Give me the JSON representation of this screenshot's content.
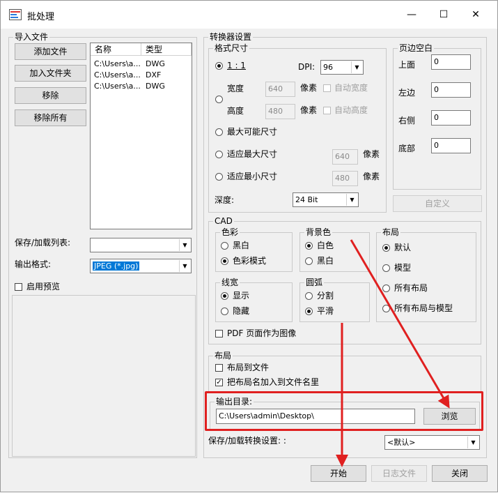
{
  "window": {
    "title": "批处理",
    "min": "—",
    "max": "☐",
    "close": "✕"
  },
  "import": {
    "title": "导入文件",
    "add_file": "添加文件",
    "add_folder": "加入文件夹",
    "remove": "移除",
    "remove_all": "移除所有",
    "columns": [
      "名称",
      "类型"
    ],
    "rows": [
      {
        "name": "C:\\Users\\a...",
        "type": "DWG"
      },
      {
        "name": "C:\\Users\\a...",
        "type": "DXF"
      },
      {
        "name": "C:\\Users\\a...",
        "type": "DWG"
      }
    ],
    "save_load_list_label": "保存/加载列表:",
    "save_load_list_value": "",
    "output_format_label": "输出格式:",
    "output_format_value": "JPEG (*.jpg)",
    "preview_label": "启用预览"
  },
  "converter": {
    "title": "转换器设置",
    "format_size": {
      "title": "格式尺寸",
      "ratio_label": "1 : 1",
      "dpi_label": "DPI:",
      "dpi_value": "96",
      "width_label": "宽度",
      "width_value": "640",
      "height_label": "高度",
      "height_value": "480",
      "pixel_label": "像素",
      "auto_width": "自动宽度",
      "auto_height": "自动高度",
      "max_size": "最大可能尺寸",
      "fit_max": "适应最大尺寸",
      "fit_max_value": "640",
      "fit_min": "适应最小尺寸",
      "fit_min_value": "480",
      "depth_label": "深度:",
      "depth_value": "24 Bit"
    },
    "margins": {
      "title": "页边空白",
      "top_label": "上面",
      "top_value": "0",
      "left_label": "左边",
      "left_value": "0",
      "right_label": "右侧",
      "right_value": "0",
      "bottom_label": "底部",
      "bottom_value": "0",
      "custom_button": "自定义"
    },
    "cad": {
      "title": "CAD",
      "color": {
        "title": "色彩",
        "bw": "黑白",
        "color_mode": "色彩模式"
      },
      "background": {
        "title": "背景色",
        "white": "白色",
        "black": "黑白"
      },
      "layout": {
        "title": "布局",
        "default": "默认",
        "model": "模型",
        "all_layouts": "所有布局",
        "all_layouts_model": "所有布局与模型"
      },
      "lineweight": {
        "title": "线宽",
        "show": "显示",
        "hide": "隐藏"
      },
      "arc": {
        "title": "圆弧",
        "split": "分割",
        "smooth": "平滑"
      },
      "pdf_as_image": "PDF 页面作为图像"
    },
    "layout_section": {
      "title": "布局",
      "layout_to_file": "布局到文件",
      "append_layout_name": "把布局名加入到文件名里"
    },
    "output_dir": {
      "label": "输出目录:",
      "value": "C:\\Users\\admin\\Desktop\\",
      "browse": "浏览"
    },
    "save_load_settings_label": "保存/加载转换设置: :",
    "save_load_settings_value": "<默认>"
  },
  "footer": {
    "start": "开始",
    "log": "日志文件",
    "close": "关闭"
  },
  "colors": {
    "annotation": "#e02020",
    "selection": "#0078d7"
  }
}
